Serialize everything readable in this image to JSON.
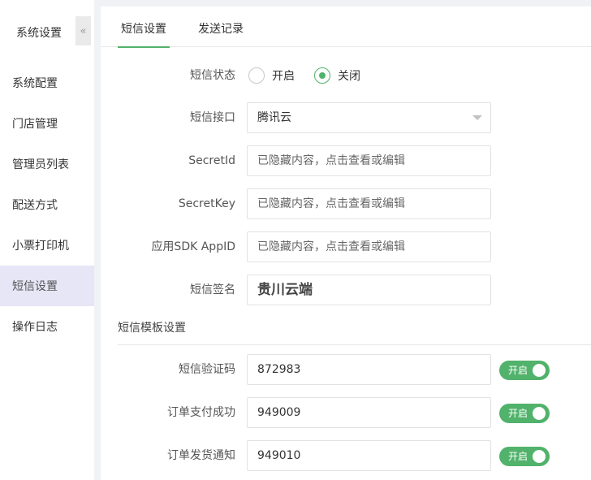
{
  "sidebar": {
    "title": "系统设置",
    "collapse_glyph": "«",
    "items": [
      {
        "label": "系统配置"
      },
      {
        "label": "门店管理"
      },
      {
        "label": "管理员列表"
      },
      {
        "label": "配送方式"
      },
      {
        "label": "小票打印机"
      },
      {
        "label": "短信设置"
      },
      {
        "label": "操作日志"
      }
    ],
    "active_item": "短信设置"
  },
  "tabs": [
    {
      "label": "短信设置",
      "active": true
    },
    {
      "label": "发送记录",
      "active": false
    }
  ],
  "form": {
    "status": {
      "label": "短信状态",
      "options": [
        {
          "label": "开启",
          "checked": false
        },
        {
          "label": "关闭",
          "checked": true
        }
      ]
    },
    "interface": {
      "label": "短信接口",
      "value": "腾讯云"
    },
    "secret_id": {
      "label": "SecretId",
      "placeholder": "已隐藏内容，点击查看或编辑"
    },
    "secret_key": {
      "label": "SecretKey",
      "placeholder": "已隐藏内容，点击查看或编辑"
    },
    "app_id": {
      "label": "应用SDK AppID",
      "placeholder": "已隐藏内容，点击查看或编辑"
    },
    "signature": {
      "label": "短信签名",
      "value": "贵川云端"
    }
  },
  "templates": {
    "section_title": "短信模板设置",
    "items": [
      {
        "label": "短信验证码",
        "value": "872983",
        "toggle": "开启"
      },
      {
        "label": "订单支付成功",
        "value": "949009",
        "toggle": "开启"
      },
      {
        "label": "订单发货通知",
        "value": "949010",
        "toggle": "开启"
      }
    ]
  },
  "colors": {
    "accent": "#51b26b",
    "sidebar_active_bg": "#e6e6f7",
    "page_bg": "#f0f2f5"
  }
}
